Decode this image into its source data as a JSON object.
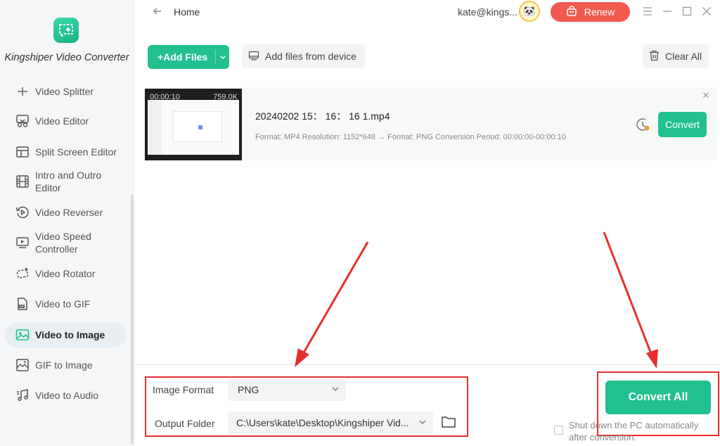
{
  "app": {
    "name": "Kingshiper Video Converter"
  },
  "sidebar": {
    "items": [
      {
        "label": "Video Splitter",
        "icon": "splitter-icon"
      },
      {
        "label": "Video Editor",
        "icon": "scissors-icon"
      },
      {
        "label": "Split Screen Editor",
        "icon": "split-screen-icon"
      },
      {
        "label": "Intro and Outro Editor",
        "icon": "film-icon"
      },
      {
        "label": "Video Reverser",
        "icon": "reverse-play-icon"
      },
      {
        "label": "Video Speed Controller",
        "icon": "speed-monitor-icon"
      },
      {
        "label": "Video Rotator",
        "icon": "rotate-icon"
      },
      {
        "label": "Video to GIF",
        "icon": "gif-file-icon"
      },
      {
        "label": "Video to Image",
        "icon": "image-icon",
        "active": true
      },
      {
        "label": "GIF to Image",
        "icon": "gif-image-icon"
      },
      {
        "label": "Video to Audio",
        "icon": "audio-icon"
      }
    ]
  },
  "header": {
    "breadcrumb": "Home",
    "user": "kate@kings...",
    "renew_label": "Renew"
  },
  "toolbar": {
    "add_files_label": "+Add Files",
    "add_from_device_label": "Add files from device",
    "clear_all_label": "Clear All"
  },
  "file": {
    "duration": "00:00:10",
    "size": "759.0K",
    "name": "20240202 15： 16： 16 1.mp4",
    "info": "Format: MP4 Resolution: 1152*648 → Format: PNG   Conversion Period: 00:00:00-00:00:10",
    "convert_label": "Convert"
  },
  "options": {
    "image_format_label": "Image Format",
    "image_format_value": "PNG",
    "output_folder_label": "Output Folder",
    "output_folder_value": "C:\\Users\\kate\\Desktop\\Kingshiper Vid..."
  },
  "actions": {
    "convert_all_label": "Convert All",
    "shutdown_label": "Shut down the PC automatically after conversion.",
    "shutdown_checked": false
  },
  "colors": {
    "accent": "#21c08e",
    "renew": "#f05a4f",
    "highlight": "#e62e2e"
  }
}
